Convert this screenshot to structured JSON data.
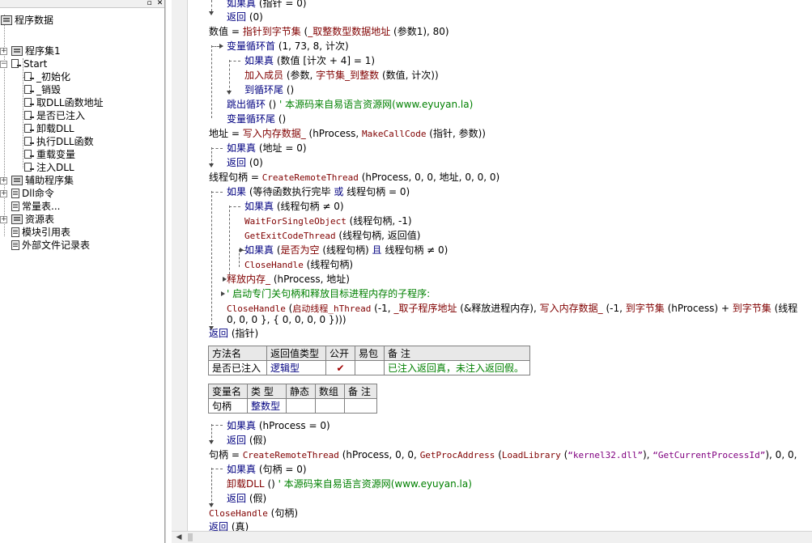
{
  "tree": {
    "root": "程序数据",
    "program_set": "程序集1",
    "start": "Start",
    "methods": [
      "_初始化",
      "_销毁",
      "取DLL函数地址",
      "是否已注入",
      "卸载DLL",
      "执行DLL函数",
      "重载变量",
      "注入DLL"
    ],
    "helper_set": "辅助程序集",
    "dll_commands": "Dll命令",
    "constants": "常量表...",
    "resources": "资源表",
    "module_refs": "模块引用表",
    "external_files": "外部文件记录表"
  },
  "code": {
    "l01": {
      "kw": "如果真",
      "rest": " (指针 = 0)"
    },
    "l02": {
      "kw": "返回",
      "rest": " (0)"
    },
    "l03": {
      "a": "数值 = ",
      "fn": "指针到字节集",
      "b": " (",
      "fn2": "_取整数型数据地址",
      "c": " (参数1), 80)"
    },
    "l04": {
      "kw": "变量循环首",
      "rest": " (1, 73, 8, 计次)"
    },
    "l05": {
      "kw": "如果真",
      "rest": " (数值 [计次 + 4] = 1)"
    },
    "l06": {
      "kw": "加入成员",
      "a": " (参数, ",
      "fn": "字节集_到整数",
      "b": " (数值, 计次))"
    },
    "l07": {
      "kw": "到循环尾",
      "rest": " ()"
    },
    "l08": {
      "kw": "跳出循环",
      "rest": " () ",
      "comment": "' 本源码来自易语言资源网(www.eyuyan.la)"
    },
    "l09": {
      "kw": "变量循环尾",
      "rest": " ()"
    },
    "l10": {
      "a": "地址 = ",
      "fn": "写入内存数据_",
      "b": " (hProcess, ",
      "fn2": "MakeCallCode",
      "c": " (指针, 参数))"
    },
    "l11": {
      "kw": "如果真",
      "rest": " (地址 = 0)"
    },
    "l12": {
      "kw": "返回",
      "rest": " (0)"
    },
    "l13": {
      "a": "线程句柄 = ",
      "fn": "CreateRemoteThread",
      "b": " (hProcess, 0, 0, 地址, 0, 0, 0)"
    },
    "l14": {
      "kw": "如果",
      "rest": " (等待函数执行完毕 ",
      "kw2": "或",
      "rest2": " 线程句柄 = 0)"
    },
    "l15": {
      "kw": "如果真",
      "rest": " (线程句柄 ≠ 0)"
    },
    "l16": {
      "fn": "WaitForSingleObject",
      "rest": " (线程句柄, -1)"
    },
    "l17": {
      "fn": "GetExitCodeThread",
      "rest": " (线程句柄, 返回值)"
    },
    "l18": {
      "kw": "如果真",
      "a": " (",
      "fn": "是否为空",
      "b": " (线程句柄) ",
      "kw2": "且",
      "c": " 线程句柄 ≠ 0)"
    },
    "l19": {
      "fn": "CloseHandle",
      "rest": " (线程句柄)"
    },
    "l20": {
      "fn": "释放内存_",
      "rest": " (hProcess, 地址)"
    },
    "l21": {
      "comment": "' 启动专门关句柄和释放目标进程内存的子程序:"
    },
    "l22": {
      "fn": "CloseHandle",
      "a": " (",
      "fn2": "启动线程_hThread",
      "b": " (-1, ",
      "fn3": "_取子程序地址",
      "c": " (&释放进程内存), ",
      "fn4": "写入内存数据_",
      "d": " (-1, ",
      "fn5": "到字节集",
      "e": " (hProcess) + ",
      "fn6": "到字节集",
      "f": " (线程"
    },
    "l23": {
      "rest": "0, 0, 0 }, { 0, 0, 0, 0 })))"
    },
    "l24": {
      "kw": "返回",
      "rest": " (指针)"
    },
    "l25": {
      "kw": "如果真",
      "rest": " (hProcess = 0)"
    },
    "l26": {
      "kw": "返回",
      "rest": " (假)"
    },
    "l27": {
      "a": "句柄 = ",
      "fn": "CreateRemoteThread",
      "b": " (hProcess, 0, 0, ",
      "fn2": "GetProcAddress",
      "c": " (",
      "fn3": "LoadLibrary",
      "d": " (",
      "s1": "“kernel32.dll”",
      "e": "), ",
      "s2": "“GetCurrentProcessId”",
      "f": "), 0, 0,"
    },
    "l28": {
      "kw": "如果真",
      "rest": " (句柄 = 0)"
    },
    "l29": {
      "fn": "卸载DLL",
      "rest": " () ",
      "comment": "' 本源码来自易语言资源网(www.eyuyan.la)"
    },
    "l30": {
      "kw": "返回",
      "rest": " (假)"
    },
    "l31": {
      "fn": "CloseHandle",
      "rest": " (句柄)"
    },
    "l32": {
      "kw": "返回",
      "rest": " (真)"
    }
  },
  "method_table": {
    "headers": [
      "方法名",
      "返回值类型",
      "公开",
      "易包",
      "备 注"
    ],
    "row": {
      "name": "是否已注入",
      "return_type": "逻辑型",
      "public_mark": "✔",
      "easy_pkg": "",
      "note": "已注入返回真，未注入返回假。"
    }
  },
  "var_table": {
    "headers": [
      "变量名",
      "类 型",
      "静态",
      "数组",
      "备 注"
    ],
    "row": {
      "name": "句柄",
      "type": "整数型",
      "static": "",
      "array": "",
      "note": ""
    }
  },
  "colors": {
    "keyword": "#000080",
    "function": "#800000",
    "comment": "#008000",
    "string": "#800080",
    "check": "#a00000"
  }
}
